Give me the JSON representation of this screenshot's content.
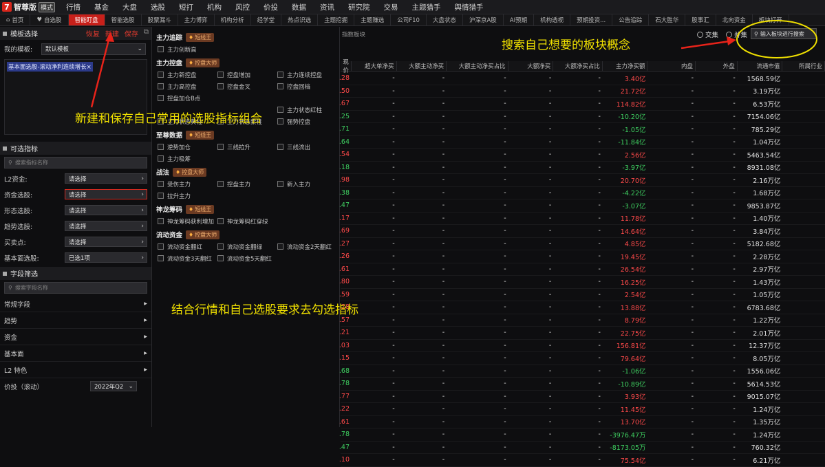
{
  "app": {
    "logo_char": "7",
    "name": "智尊版",
    "badge": "模式"
  },
  "menu": [
    "行情",
    "基金",
    "大盘",
    "选股",
    "短打",
    "机构",
    "风控",
    "价投",
    "数据",
    "资讯",
    "研究院",
    "交易",
    "主题猎手",
    "舆情猎手"
  ],
  "tabs": [
    {
      "label": "首页",
      "icon": "home-icon"
    },
    {
      "label": "自选股",
      "icon": "heart-icon"
    },
    {
      "label": "智能盯盘",
      "active": true
    },
    {
      "label": "智能选股"
    },
    {
      "label": "股票漏斗"
    },
    {
      "label": "主力博弈"
    },
    {
      "label": "机构分析"
    },
    {
      "label": "经学堂"
    },
    {
      "label": "热点识选"
    },
    {
      "label": "主题挖掘"
    },
    {
      "label": "主题赚选"
    },
    {
      "label": "公司F10"
    },
    {
      "label": "大盘状态"
    },
    {
      "label": "沪深京A股"
    },
    {
      "label": "AI预期"
    },
    {
      "label": "机构透视"
    },
    {
      "label": "预期投资..."
    },
    {
      "label": "公告追踪"
    },
    {
      "label": "石大胜华"
    },
    {
      "label": "股事汇"
    },
    {
      "label": "北向资金"
    },
    {
      "label": "板块打开"
    }
  ],
  "left": {
    "template_title": "模板选择",
    "restore": "恢复",
    "new": "新建",
    "save": "保存",
    "my_template_label": "我的模板:",
    "my_template_value": "默认模板",
    "selected_combo": "基本面选股-滚动净利连续增长×",
    "indicators_title": "可选指标",
    "search_indicator": "搜索指标名称",
    "filters": [
      {
        "label": "L2资金:",
        "value": "请选择"
      },
      {
        "label": "资金选股:",
        "value": "请选择"
      },
      {
        "label": "形态选股:",
        "value": "请选择"
      },
      {
        "label": "趋势选股:",
        "value": "请选择"
      },
      {
        "label": "买卖点:",
        "value": "请选择"
      },
      {
        "label": "基本面选股:",
        "value": "已选1项"
      }
    ],
    "fields_title": "字段筛选",
    "search_field": "搜索字段名称",
    "field_groups": [
      "常规字段",
      "趋势",
      "资金",
      "基本面",
      "L2 特色"
    ],
    "valuation_label": "价投（滚动）",
    "valuation_value": "2022年Q2"
  },
  "middle": {
    "groups": [
      {
        "title": "主力追踪",
        "badge": "短线王",
        "items": [
          "主力创新高"
        ]
      },
      {
        "title": "主力控盘",
        "badge": "控盘大师",
        "items": [
          "主力新控盘",
          "控盘增加",
          "主力连续控盘",
          "主力高控盘",
          "控盘金叉",
          "控盘回档",
          "控盘加仓B点",
          "",
          "",
          "主力状态红柱",
          "主力状态黄柱",
          "主力状态紫柱",
          "强势控盘"
        ]
      },
      {
        "title": "至尊数据",
        "badge": "短线王",
        "items": [
          "逆势加仓",
          "三线拉升",
          "三线流出",
          "主力吸筹"
        ]
      },
      {
        "title": "战法",
        "badge": "控盘大师",
        "items": [
          "受伤主力",
          "控盘主力",
          "新入主力",
          "拉升主力"
        ]
      },
      {
        "title": "神龙筹码",
        "badge": "短线王",
        "items": [
          "神龙筹码获利增加",
          "神龙筹码红穿绿"
        ]
      },
      {
        "title": "流动资金",
        "badge": "控盘大师",
        "items": [
          "流动资金翻红",
          "流动资金翻绿",
          "流动资金2天翻红",
          "流动资金3天翻红",
          "流动资金5天翻红"
        ]
      }
    ]
  },
  "right": {
    "sector_label": "指数板块",
    "intersect": "交集",
    "union": "并集",
    "search_placeholder": "输入板块进行搜索",
    "columns": [
      "现价",
      "超大单净买",
      "大额主动净买",
      "大额主动净买占比",
      "大额净买",
      "大额净买占比",
      "主力净买额",
      "内盘",
      "外盘",
      "流通市值",
      "所属行业"
    ],
    "rows": [
      [
        ".28",
        "3.40亿",
        "1568.59亿"
      ],
      [
        ".50",
        "21.72亿",
        "3.19万亿"
      ],
      [
        ".67",
        "114.82亿",
        "6.53万亿"
      ],
      [
        ".25",
        "-10.20亿",
        "7154.06亿"
      ],
      [
        ".71",
        "-1.05亿",
        "785.29亿"
      ],
      [
        ".64",
        "-11.84亿",
        "1.04万亿"
      ],
      [
        ".54",
        "2.56亿",
        "5463.54亿"
      ],
      [
        ".18",
        "-3.97亿",
        "8931.08亿"
      ],
      [
        ".98",
        "20.70亿",
        "2.16万亿"
      ],
      [
        ".38",
        "-4.22亿",
        "1.68万亿"
      ],
      [
        ".47",
        "-3.07亿",
        "9853.87亿"
      ],
      [
        ".17",
        "11.78亿",
        "1.40万亿"
      ],
      [
        ".69",
        "14.64亿",
        "3.84万亿"
      ],
      [
        ".27",
        "4.85亿",
        "5182.68亿"
      ],
      [
        ".26",
        "19.45亿",
        "2.28万亿"
      ],
      [
        ".61",
        "26.54亿",
        "2.97万亿"
      ],
      [
        ".80",
        "16.25亿",
        "1.43万亿"
      ],
      [
        ".59",
        "2.54亿",
        "1.05万亿"
      ],
      [
        ".28",
        "13.88亿",
        "6783.68亿"
      ],
      [
        ".57",
        "8.79亿",
        "1.22万亿"
      ],
      [
        ".21",
        "22.75亿",
        "2.01万亿"
      ],
      [
        ".03",
        "156.81亿",
        "12.37万亿"
      ],
      [
        ".15",
        "79.64亿",
        "8.05万亿"
      ],
      [
        ".68",
        "-1.06亿",
        "1556.06亿"
      ],
      [
        ".78",
        "-10.89亿",
        "5614.53亿"
      ],
      [
        ".77",
        "3.93亿",
        "9015.07亿"
      ],
      [
        ".22",
        "11.45亿",
        "1.24万亿"
      ],
      [
        ".61",
        "13.70亿",
        "1.35万亿"
      ],
      [
        ".78",
        "-3976.47万",
        "1.24万亿"
      ],
      [
        ".47",
        "-8173.05万",
        "760.32亿"
      ],
      [
        ".10",
        "75.54亿",
        "6.21万亿"
      ]
    ]
  },
  "annotations": {
    "new_save": "新建和保存自己常用的选股指标组合",
    "search": "搜索自己想要的板块概念",
    "check": "结合行情和自己选股要求去勾选指标"
  },
  "colors": {
    "accent": "#c8201a",
    "up": "#ff4a4a",
    "down": "#3fd061",
    "annotation": "#f0e000"
  }
}
